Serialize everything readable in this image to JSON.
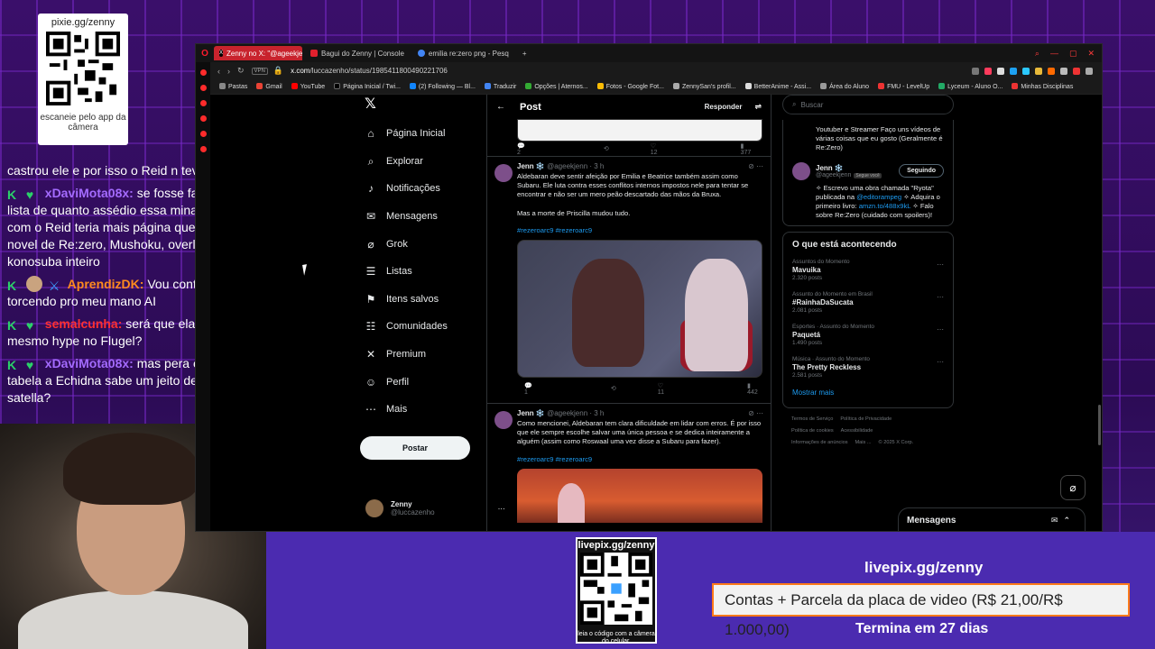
{
  "overlay": {
    "qr_top": {
      "url": "pixie.gg/zenny",
      "hint": "escaneie pelo app da câmera"
    },
    "qr_bottom": {
      "url": "livepix.gg/zenny",
      "hint": "leia o código com a câmera do celular."
    },
    "livepix_url": "livepix.gg/zenny",
    "goal_text": "Contas + Parcela da placa de video (R$ 21,00/R$ 1.000,00)",
    "goal_progress": 0.021,
    "goal_deadline": "Termina em 27 dias"
  },
  "chat": [
    {
      "user": "",
      "text": "castrou ele e por isso o Reid n teve filhos",
      "color": "#ffffff"
    },
    {
      "user": "xDaviMota08x:",
      "text": "se fosse fazer uma lista de quanto assédio essa mina sofreu com o Reid teria mais página que a light novel de Re:zero, Mushoku, overlord e konosuba inteiro",
      "color": "#a46bff"
    },
    {
      "user": "AprendizDK:",
      "text": "Vou continuar torcendo pro meu mano AI",
      "color": "#ff8a1e"
    },
    {
      "user": "semalcunha:",
      "text": "será que ela botava o mesmo hype no Flugel?",
      "color": "#ff3030"
    },
    {
      "user": "xDaviMota08x:",
      "text": "mas pera então por tabela a Echidna sabe um jeito de matar a satella?",
      "color": "#a46bff"
    }
  ],
  "browser": {
    "tabs": [
      {
        "label": "Zenny no X: \"@ageekjenn",
        "active": true
      },
      {
        "label": "Bagui do Zenny | Console",
        "active": false
      },
      {
        "label": "emilia re:zero png - Pesq",
        "active": false
      }
    ],
    "url_host": "x.com",
    "url_path": "/luccazenho/status/1985411800490221706",
    "bookmarks": [
      "Pastas",
      "Gmail",
      "YouTube",
      "Página Inicial / Twi...",
      "(2) Following — Bl...",
      "Traduzir",
      "Opções | Aternos...",
      "Fotos - Google Fot...",
      "ZennySan's profil...",
      "BetterAnime - Assi...",
      "Área do Aluno",
      "FMU - LevelUp",
      "Lyceum - Aluno O...",
      "Minhas Disciplinas"
    ]
  },
  "x": {
    "nav": [
      {
        "icon": "home-icon",
        "glyph": "⌂",
        "label": "Página Inicial"
      },
      {
        "icon": "search-icon",
        "glyph": "⌕",
        "label": "Explorar"
      },
      {
        "icon": "bell-icon",
        "glyph": "🔔",
        "label": "Notificações"
      },
      {
        "icon": "mail-icon",
        "glyph": "✉",
        "label": "Mensagens"
      },
      {
        "icon": "grok-icon",
        "glyph": "⌀",
        "label": "Grok"
      },
      {
        "icon": "list-icon",
        "glyph": "☰",
        "label": "Listas"
      },
      {
        "icon": "bookmark-icon",
        "glyph": "🔖",
        "label": "Itens salvos"
      },
      {
        "icon": "community-icon",
        "glyph": "👥",
        "label": "Comunidades"
      },
      {
        "icon": "premium-icon",
        "glyph": "𝕏",
        "label": "Premium"
      },
      {
        "icon": "profile-icon",
        "glyph": "👤",
        "label": "Perfil"
      },
      {
        "icon": "more-icon",
        "glyph": "⋯",
        "label": "Mais"
      }
    ],
    "post_button": "Postar",
    "account": {
      "name": "Zenny",
      "handle": "@luccazenho"
    },
    "center": {
      "title": "Post",
      "reply_label": "Responder",
      "top_stats": {
        "replies": "2",
        "likes": "12",
        "views": "377"
      },
      "tweets": [
        {
          "name": "Jenn ❄️",
          "handle": "@ageekjenn",
          "time": "· 3 h",
          "text": "Aldebaran deve sentir afeição por Emilia e Beatrice também assim como Subaru. Ele luta contra esses conflitos internos impostos nele para tentar se encontrar e não ser um mero peão descartado das mãos da Bruxa.\n\nMas a morte de Priscilla mudou tudo.",
          "tags": "#rezeroarc9 #rezeroarc9",
          "stats": {
            "replies": "1",
            "likes": "11",
            "views": "442"
          }
        },
        {
          "name": "Jenn ❄️",
          "handle": "@ageekjenn",
          "time": "· 3 h",
          "text": "Como mencionei, Aldebaran tem clara dificuldade em lidar com erros. É por isso que ele sempre escolhe salvar uma única pessoa e se dedica inteiramente a alguém (assim como Roswaal uma vez disse a Subaru para fazer).",
          "tags": "#rezeroarc9 #rezeroarc9"
        }
      ]
    },
    "right": {
      "search_placeholder": "Buscar",
      "bio_top": "Youtuber e Streamer Faço uns vídeos de várias coisas que eu gosto (Geralmente é Re:Zero)",
      "who": {
        "name": "Jenn ❄️",
        "handle": "@ageekjenn",
        "badge": "Segue você",
        "button": "Seguindo"
      },
      "who_bio_1": "✧ Escrevo uma obra chamada \"Ryota\" publicada na ",
      "who_bio_link1": "@editorampeg",
      "who_bio_2": " ✧ Adquira o primeiro livro: ",
      "who_bio_link2": "amzn.to/488x9kL",
      "who_bio_3": " ✧ Falo sobre Re:Zero (cuidado com spoilers)!",
      "trends_title": "O que está acontecendo",
      "trends": [
        {
          "category": "Assuntos do Momento",
          "name": "Mavuika",
          "count": "2.320 posts"
        },
        {
          "category": "Assunto do Momento em Brasil",
          "name": "#RainhaDaSucata",
          "count": "2.081 posts"
        },
        {
          "category": "Esportes · Assunto do Momento",
          "name": "Paquetá",
          "count": "1.490 posts"
        },
        {
          "category": "Música · Assunto do Momento",
          "name": "The Pretty Reckless",
          "count": "2.581 posts"
        }
      ],
      "show_more": "Mostrar mais",
      "footer": [
        "Termos de Serviço",
        "Política de Privacidade",
        "Política de cookies",
        "Acessibilidade",
        "Informações de anúncios",
        "Mais ...",
        "© 2025 X Corp."
      ]
    },
    "messages_dock": "Mensagens"
  }
}
